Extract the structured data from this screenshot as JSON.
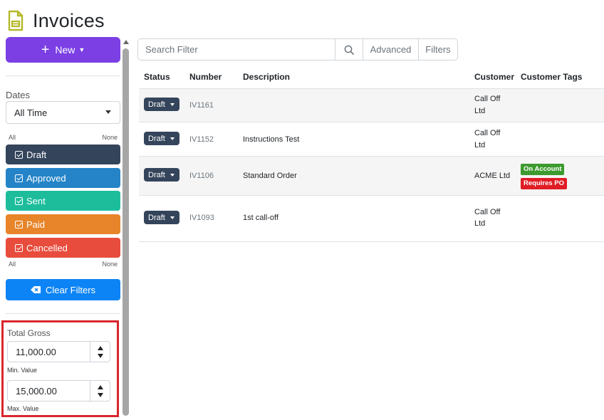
{
  "header": {
    "title": "Invoices",
    "icon": "invoice-document-icon",
    "icon_color": "#b5b829"
  },
  "sidebar": {
    "new_button": {
      "label": "New",
      "color": "#7b3fe4"
    },
    "dates": {
      "label": "Dates",
      "selected": "All Time"
    },
    "status_filter": {
      "all_label": "All",
      "none_label": "None",
      "items": [
        {
          "label": "Draft",
          "color": "#34455b",
          "checked": true
        },
        {
          "label": "Approved",
          "color": "#2584c8",
          "checked": true
        },
        {
          "label": "Sent",
          "color": "#1dbd9c",
          "checked": true
        },
        {
          "label": "Paid",
          "color": "#e8852a",
          "checked": true
        },
        {
          "label": "Cancelled",
          "color": "#e84c3d",
          "checked": true
        }
      ]
    },
    "clear_filters": {
      "label": "Clear Filters",
      "color": "#0d84f5"
    },
    "total_gross": {
      "label": "Total Gross",
      "min_value": "11,000.00",
      "min_label": "Min. Value",
      "max_value": "15,000.00",
      "max_label": "Max. Value"
    }
  },
  "search": {
    "placeholder": "Search Filter",
    "advanced_label": "Advanced",
    "filters_label": "Filters"
  },
  "table": {
    "columns": [
      "Status",
      "Number",
      "Description",
      "Customer",
      "Customer Tags"
    ],
    "rows": [
      {
        "status": "Draft",
        "number": "IV1161",
        "description": "",
        "customer_line1": "Call Off",
        "customer_line2": "Ltd",
        "tags": []
      },
      {
        "status": "Draft",
        "number": "IV1152",
        "description": "Instructions Test",
        "customer_line1": "Call Off",
        "customer_line2": "Ltd",
        "tags": []
      },
      {
        "status": "Draft",
        "number": "IV1106",
        "description": "Standard Order",
        "customer_line1": "ACME Ltd",
        "customer_line2": "",
        "tags": [
          {
            "label": "On Account",
            "color": "#3c9a2e"
          },
          {
            "label": "Requires PO",
            "color": "#e01c24"
          }
        ]
      },
      {
        "status": "Draft",
        "number": "IV1093",
        "description": "1st call-off",
        "customer_line1": "Call Off",
        "customer_line2": "Ltd",
        "tags": []
      }
    ]
  }
}
